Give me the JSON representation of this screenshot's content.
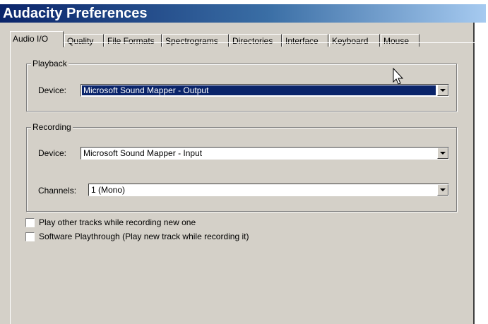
{
  "window": {
    "title": "Audacity Preferences"
  },
  "tabs": [
    {
      "label": "Audio I/O",
      "active": true
    },
    {
      "label": "Quality"
    },
    {
      "label": "File Formats"
    },
    {
      "label": "Spectrograms"
    },
    {
      "label": "Directories"
    },
    {
      "label": "Interface"
    },
    {
      "label": "Keyboard"
    },
    {
      "label": "Mouse"
    }
  ],
  "playback": {
    "group_label": "Playback",
    "device_label": "Device:",
    "device_value": "Microsoft Sound Mapper - Output"
  },
  "recording": {
    "group_label": "Recording",
    "device_label": "Device:",
    "device_value": "Microsoft Sound Mapper - Input",
    "channels_label": "Channels:",
    "channels_value": "1 (Mono)"
  },
  "options": [
    {
      "label": "Play other tracks while recording new one",
      "checked": false
    },
    {
      "label": "Software Playthrough (Play new track while recording it)",
      "checked": false
    }
  ]
}
